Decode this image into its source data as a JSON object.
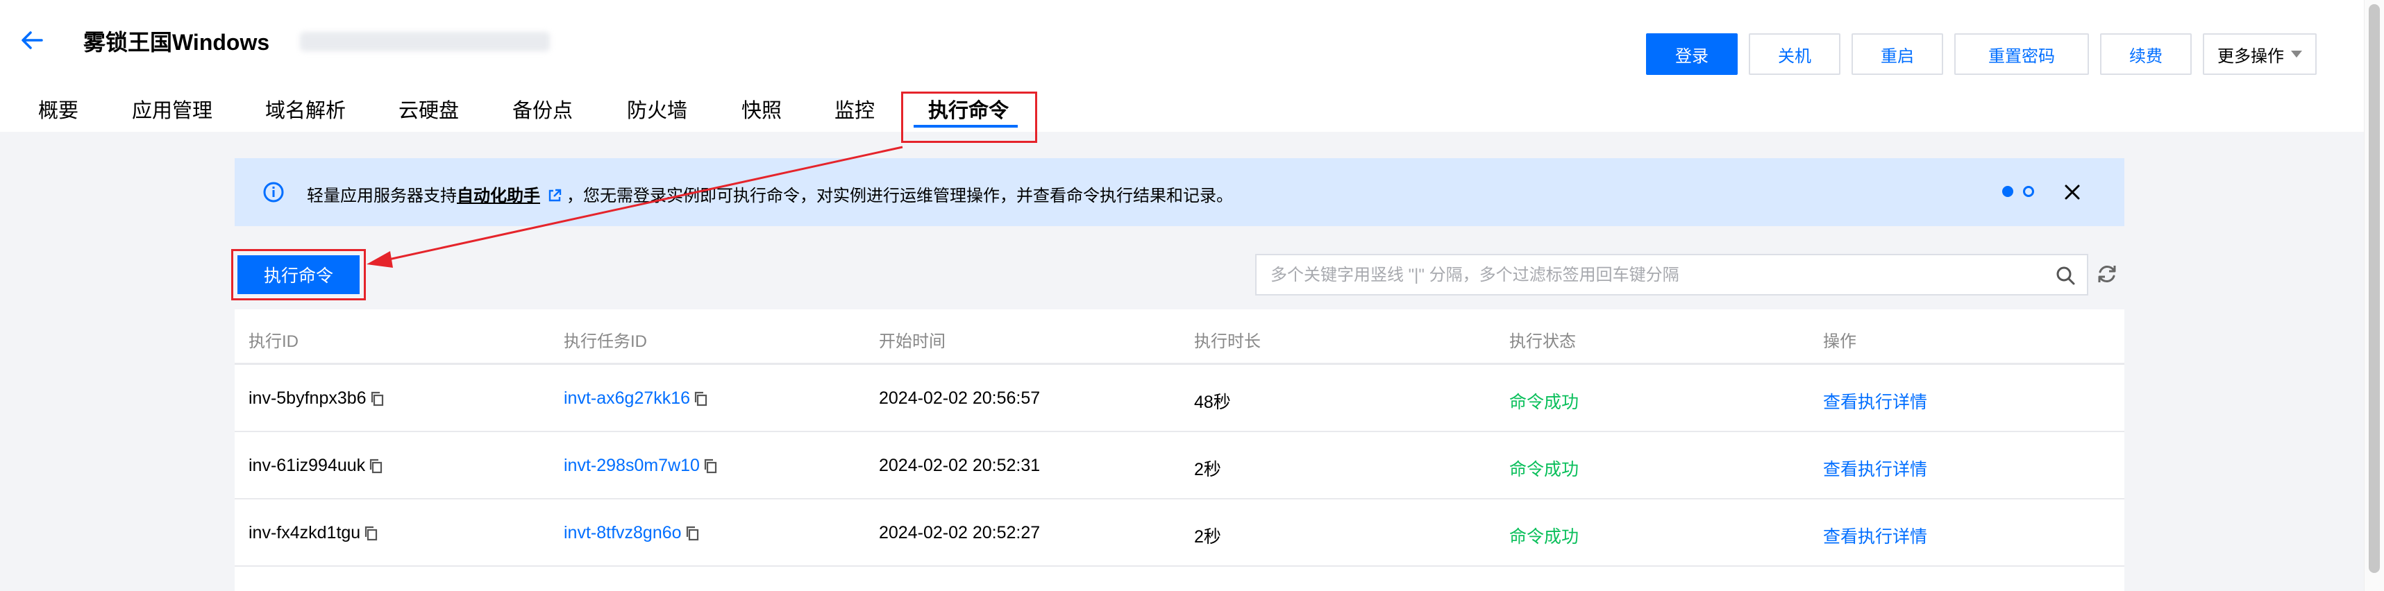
{
  "header": {
    "title": "雾锁王国Windows",
    "actions": {
      "login": "登录",
      "shutdown": "关机",
      "restart": "重启",
      "reset_password": "重置密码",
      "renew": "续费",
      "more": "更多操作"
    }
  },
  "tabs": [
    {
      "label": "概要"
    },
    {
      "label": "应用管理"
    },
    {
      "label": "域名解析"
    },
    {
      "label": "云硬盘"
    },
    {
      "label": "备份点"
    },
    {
      "label": "防火墙"
    },
    {
      "label": "快照"
    },
    {
      "label": "监控"
    },
    {
      "label": "执行命令",
      "active": true
    }
  ],
  "banner": {
    "text_before": "轻量应用服务器支持",
    "link": "自动化助手",
    "text_after": "，您无需登录实例即可执行命令，对实例进行运维管理操作，并查看命令执行结果和记录。"
  },
  "toolbar": {
    "exec_button": "执行命令",
    "search_placeholder": "多个关键字用竖线 \"|\" 分隔，多个过滤标签用回车键分隔"
  },
  "table": {
    "columns": [
      "执行ID",
      "执行任务ID",
      "开始时间",
      "执行时长",
      "执行状态",
      "操作"
    ],
    "rows": [
      {
        "exec_id": "inv-5byfnpx3b6",
        "task_id": "invt-ax6g27kk16",
        "start_time": "2024-02-02 20:56:57",
        "duration": "48秒",
        "status": "命令成功",
        "action": "查看执行详情"
      },
      {
        "exec_id": "inv-61iz994uuk",
        "task_id": "invt-298s0m7w10",
        "start_time": "2024-02-02 20:52:31",
        "duration": "2秒",
        "status": "命令成功",
        "action": "查看执行详情"
      },
      {
        "exec_id": "inv-fx4zkd1tgu",
        "task_id": "invt-8tfvz8gn6o",
        "start_time": "2024-02-02 20:52:27",
        "duration": "2秒",
        "status": "命令成功",
        "action": "查看执行详情"
      }
    ]
  },
  "colors": {
    "primary": "#006eff",
    "success": "#0abf5b",
    "annotation": "#e5242b",
    "banner_bg": "#d9e9ff"
  }
}
